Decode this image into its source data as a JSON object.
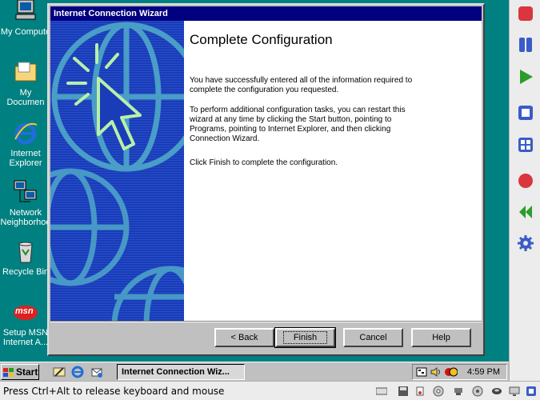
{
  "desktop": {
    "icons": [
      {
        "label": "My Compute"
      },
      {
        "label": "My Documen"
      },
      {
        "label": "Internet Explorer"
      },
      {
        "label": "Network Neighborhoo"
      },
      {
        "label": "Recycle Bin"
      },
      {
        "label": "Setup MSN Internet A..."
      }
    ],
    "msn_logo_text": "msn"
  },
  "wizard": {
    "title": "Internet Connection Wizard",
    "heading": "Complete Configuration",
    "paragraphs": [
      "You have successfully entered all of the information required to complete the configuration you requested.",
      "To perform additional configuration tasks, you can restart this wizard at any time by clicking the Start button, pointing to Programs, pointing to Internet Explorer, and then clicking Connection Wizard.",
      "Click Finish to complete the configuration."
    ],
    "buttons": {
      "back": "< Back",
      "finish": "Finish",
      "cancel": "Cancel",
      "help": "Help"
    }
  },
  "taskbar": {
    "start_label": "Start",
    "task_item": "Internet Connection Wiz...",
    "clock": "4:59 PM"
  },
  "statusbar": {
    "text": "Press Ctrl+Alt to release keyboard and mouse"
  },
  "colors": {
    "desktop": "#008080",
    "titlebar": "#000080",
    "sidebar_art": "#1a3cb8",
    "host_stop": "#d9363e",
    "host_play": "#2a9d2a",
    "host_blue": "#3a5cc8"
  }
}
